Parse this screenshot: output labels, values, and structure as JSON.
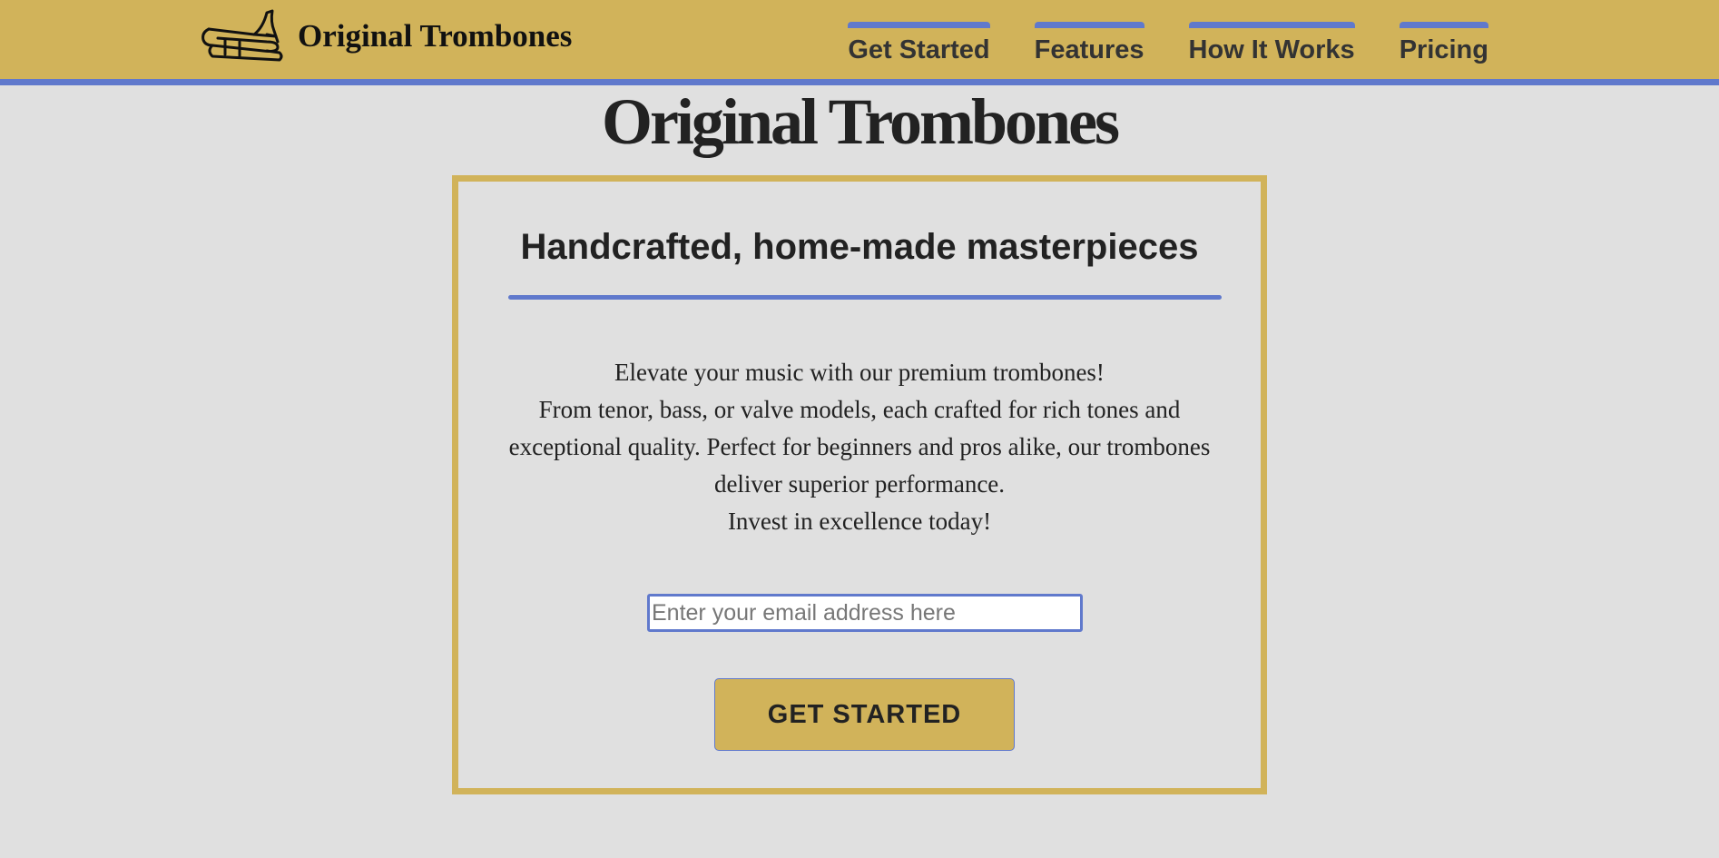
{
  "header": {
    "brand_name": "Original Trombones",
    "logo_icon": "trombone-icon",
    "nav": [
      {
        "label": "Get Started"
      },
      {
        "label": "Features"
      },
      {
        "label": "How It Works"
      },
      {
        "label": "Pricing"
      }
    ]
  },
  "main": {
    "title": "Original Trombones",
    "card": {
      "heading": "Handcrafted, home-made masterpieces",
      "body_lines": [
        "Elevate your music with our premium trombones!",
        "From tenor, bass, or valve models, each crafted for rich tones and exceptional quality. Perfect for beginners and pros alike, our trombones deliver superior performance.",
        "Invest in excellence today!"
      ],
      "email_placeholder": "Enter your email address here",
      "email_value": "",
      "button_label": "GET STARTED"
    }
  },
  "colors": {
    "gold": "#d1b35a",
    "accent_blue": "#6079cc",
    "page_background": "#e0e0e0",
    "text": "#222222"
  }
}
